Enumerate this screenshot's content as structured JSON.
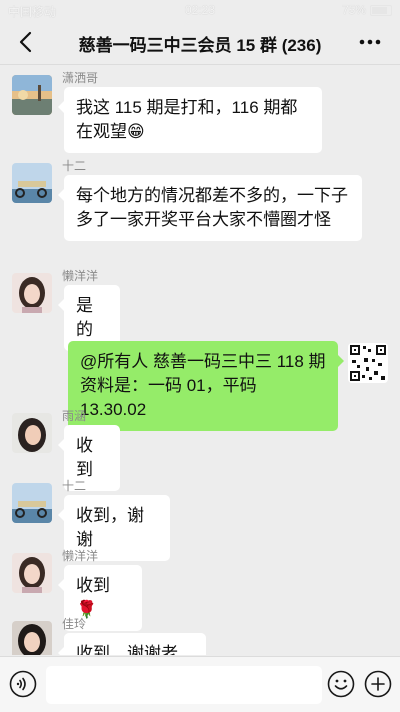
{
  "status_bar": {
    "carrier": "中国移动",
    "time": "02:23",
    "battery": "75%"
  },
  "header": {
    "title": "慈善一码三中三会员 15 群 (236)"
  },
  "messages": [
    {
      "sender": "潇洒哥",
      "text": "我这 115 期是打和，116 期都在观望😁"
    },
    {
      "sender": "十二",
      "text": "每个地方的情况都差不多的，一下子多了一家开奖平台大家不懵圈才怪"
    },
    {
      "sender": "懒洋洋",
      "text": "是的"
    },
    {
      "sender": "",
      "text": "@所有人 慈善一码三中三 118 期资料是：一码 01，平码 13.30.02"
    },
    {
      "sender": "雨涵",
      "text": "收到"
    },
    {
      "sender": "十二",
      "text": "收到，谢谢"
    },
    {
      "sender": "懒洋洋",
      "text": "收到 🌹"
    },
    {
      "sender": "佳玲",
      "text": "收到，谢谢老板"
    }
  ],
  "input": {
    "placeholder": ""
  }
}
